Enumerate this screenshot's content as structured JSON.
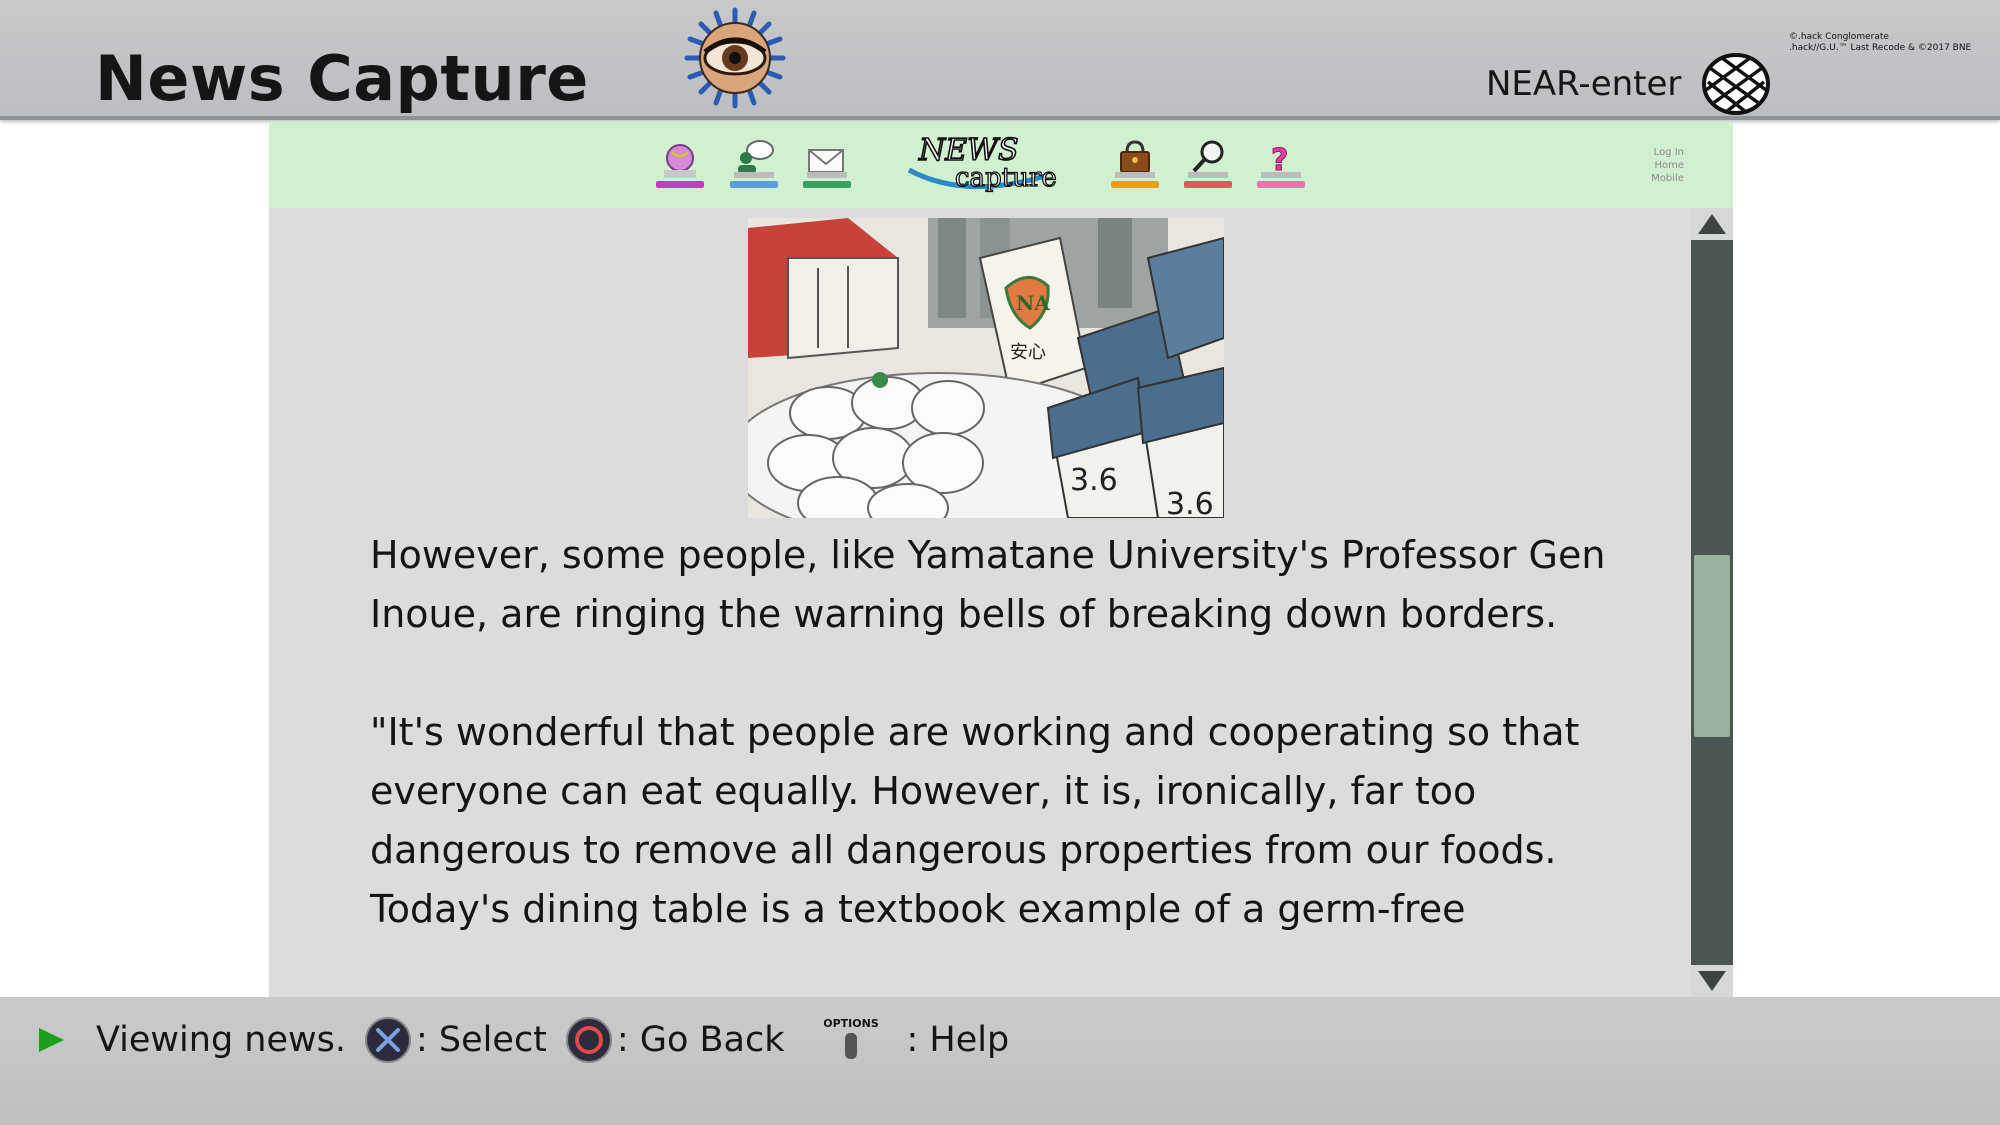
{
  "header": {
    "title": "News Capture",
    "account_label": "NEAR-enter",
    "copyright_lines": [
      "©.hack Conglomerate",
      ".hack//G.U.™ Last Recode & ©2017 BNE"
    ]
  },
  "site": {
    "logo_top": "NEWS",
    "logo_bottom": "capture",
    "nav_icons": [
      "globe-icon",
      "people-chat-icon",
      "mail-icon",
      "shop-bag-icon",
      "search-icon",
      "help-icon"
    ],
    "links": [
      "Log In",
      "Home",
      "Mobile"
    ]
  },
  "article": {
    "image_alt": "Eggs and milk cartons with safety labels",
    "image_labels": [
      "NA",
      "安心",
      "3.6",
      "3.6"
    ],
    "paragraphs": [
      "However, some people, like Yamatane University's Professor Gen Inoue, are ringing the warning bells of breaking down borders.",
      "\"It's wonderful that people are working and cooperating so that everyone can eat equally. However, it is, ironically, far too dangerous to remove all dangerous properties from our foods. Today's dining table is a textbook example of a germ-free"
    ]
  },
  "scroll": {
    "position": 0.58
  },
  "footer": {
    "status": "Viewing news.",
    "select_label": ": Select",
    "back_label": ": Go Back",
    "options_label": "OPTIONS",
    "help_label": ": Help"
  },
  "colors": {
    "nav_bg": "#d1f0d0",
    "content_bg": "#dcdcdc",
    "scroll_track": "#4b5551",
    "scroll_thumb": "#98b29c",
    "status_arrow": "#1aa01a"
  }
}
